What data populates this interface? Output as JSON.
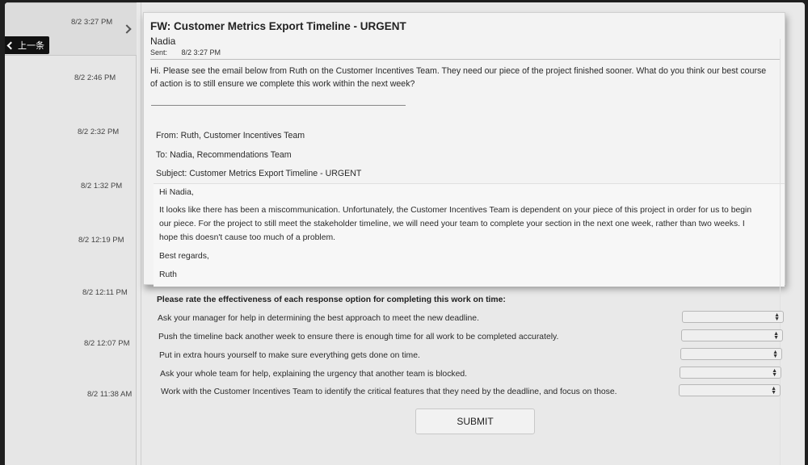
{
  "back_button": {
    "label": "上一条",
    "icon": "chevron-left-icon"
  },
  "sidebar": {
    "items": [
      {
        "time": "8/2 3:27 PM",
        "selected": true
      },
      {
        "time": "8/2 2:46 PM"
      },
      {
        "time": "8/2 2:32 PM"
      },
      {
        "time": "8/2 1:32 PM"
      },
      {
        "time": "8/2 12:19 PM"
      },
      {
        "time": "8/2 12:11 PM"
      },
      {
        "time": "8/2 12:07 PM"
      },
      {
        "time": "8/2 11:38 AM"
      }
    ]
  },
  "email": {
    "subject": "FW: Customer Metrics Export Timeline - URGENT",
    "sender": "Nadia",
    "sent_label": "Sent:",
    "sent_value": "8/2 3:27 PM",
    "body_line1": "Hi. Please see the email below from Ruth on the Customer Incentives Team. They need our piece of the project finished sooner. What do you think our best course",
    "body_line2": "of action is to still ensure we complete this work within the next week?",
    "forward": {
      "from": "From: Ruth, Customer Incentives Team",
      "to": "To: Nadia, Recommendations Team",
      "subject": "Subject: Customer Metrics Export Timeline - URGENT"
    },
    "quote": {
      "greeting": "Hi Nadia,",
      "para1": "It looks like there has been a miscommunication. Unfortunately, the Customer Incentives Team is dependent on your piece of this project in order for us to begin",
      "para2": "our piece. For the project to still meet the stakeholder timeline, we will need your team to complete your section in the next one week, rather than two weeks. I",
      "para3": "hope this doesn't cause too much of a problem.",
      "closing": "Best regards,",
      "signature": "Ruth"
    }
  },
  "rating": {
    "title": "Please rate the effectiveness of each response option for completing this work on time:",
    "options": [
      "Ask your manager for help in determining the best approach to meet the new deadline.",
      "Push the timeline back another week to ensure there is enough time for all work to be completed accurately.",
      "Put in extra hours yourself to make sure everything gets done on time.",
      "Ask your whole team for help, explaining the urgency that another team is blocked.",
      "Work with the Customer Incentives Team to identify the critical features that they need by the deadline, and focus on those."
    ],
    "submit_label": "SUBMIT"
  }
}
